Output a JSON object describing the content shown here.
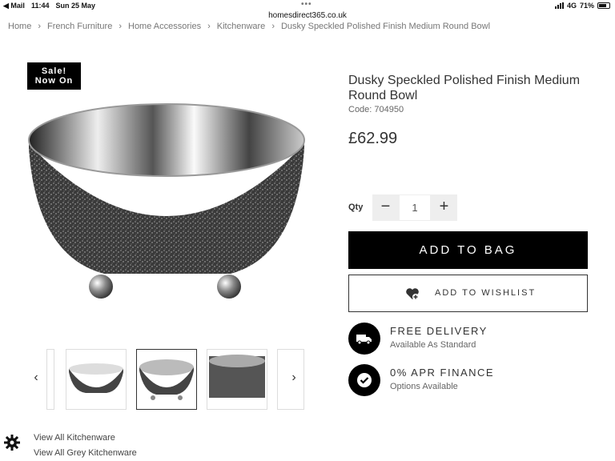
{
  "status_bar": {
    "back_app": "◀ Mail",
    "time": "11:44",
    "date": "Sun 25 May",
    "dots": "•••",
    "network": "4G",
    "battery": "71%",
    "battery_level": 0.71
  },
  "url": "homesdirect365.co.uk",
  "breadcrumb": [
    "Home",
    "French Furniture",
    "Home Accessories",
    "Kitchenware",
    "Dusky Speckled Polished Finish Medium Round Bowl"
  ],
  "breadcrumb_separator": "›",
  "sale_badge": {
    "line1": "Sale!",
    "line2": "Now On"
  },
  "product": {
    "title": "Dusky Speckled Polished Finish Medium Round Bowl",
    "code": "Code: 704950",
    "price": "£62.99"
  },
  "thumbnails": {
    "prev_icon": "‹",
    "next_icon": "›",
    "count": 5,
    "active_index": 2
  },
  "quantity": {
    "label": "Qty",
    "minus": "−",
    "value": "1",
    "plus": "+"
  },
  "buttons": {
    "add_to_bag": "ADD TO BAG",
    "wishlist": "ADD TO WISHLIST"
  },
  "features": [
    {
      "icon": "truck-icon",
      "title": "FREE DELIVERY",
      "subtitle": "Available As Standard"
    },
    {
      "icon": "checkmark-icon",
      "title": "0% APR FINANCE",
      "subtitle": "Options Available"
    }
  ],
  "links": [
    "View All Kitchenware",
    "View All Grey Kitchenware"
  ],
  "colors": {
    "primary": "#000000",
    "text": "#333333",
    "muted": "#666666"
  }
}
